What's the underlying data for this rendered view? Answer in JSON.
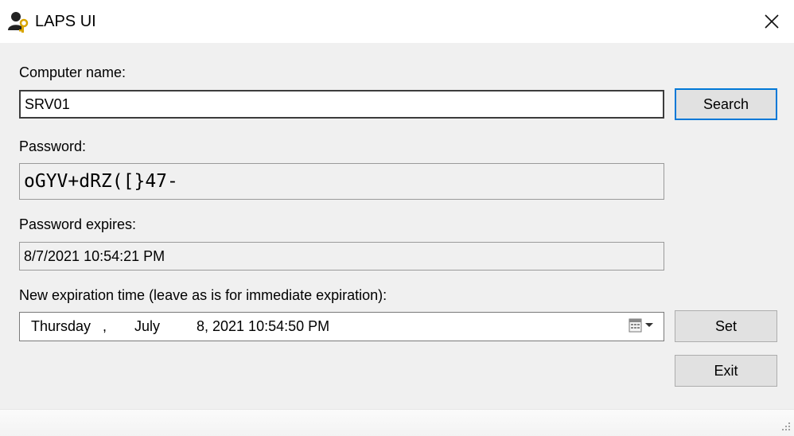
{
  "window": {
    "title": "LAPS UI",
    "close_icon": "close-icon",
    "app_icon": "laps-user-key-icon"
  },
  "form": {
    "computer_name_label": "Computer name:",
    "computer_name_value": "SRV01",
    "search_button": "Search",
    "password_label": "Password:",
    "password_value": "oGYV+dRZ([}47-",
    "password_expires_label": "Password expires:",
    "password_expires_value": "8/7/2021 10:54:21 PM",
    "new_expiration_label": "New expiration time (leave as is for immediate expiration):",
    "new_expiration": {
      "weekday": "Thursday",
      "sep": ",",
      "month": "July",
      "rest": "8, 2021 10:54:50 PM",
      "dropdown_icon": "calendar-dropdown-icon"
    },
    "set_button": "Set",
    "exit_button": "Exit"
  },
  "colors": {
    "client_bg": "#f0f0f0",
    "focus_border": "#0078d7"
  }
}
